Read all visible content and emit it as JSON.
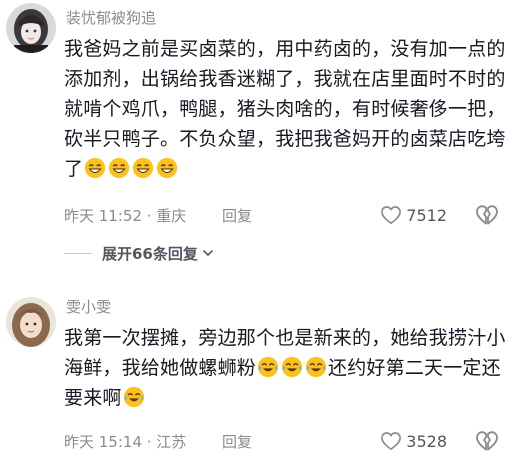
{
  "colors": {
    "text_primary": "#161823",
    "text_secondary": "#8a8b91",
    "emoji_face": "#fcc21b"
  },
  "comments": [
    {
      "username": "装忧郁被狗追",
      "text": "我爸妈之前是买卤菜的，用中药卤的，没有加一点的添加剂，出锅给我香迷糊了，我就在店里面时不时的就啃个鸡爪，鸭腿，猪头肉啥的，有时候奢侈一把，砍半只鸭子。不负众望，我把我爸妈开的卤菜店吃垮了",
      "emojis": [
        "grin-emoji",
        "grin-emoji",
        "grin-emoji",
        "grin-emoji"
      ],
      "meta": "昨天 11:52 · 重庆",
      "reply_label": "回复",
      "like_count": "7512",
      "expand_label": "展开66条回复"
    },
    {
      "username": "雯小雯",
      "text_before": "我第一次摆摊，旁边那个也是新来的，她给我捞汁小海鲜，我给她做螺蛳粉",
      "emojis_mid": [
        "laugh-cry-emoji",
        "laugh-cry-emoji",
        "laugh-cry-emoji"
      ],
      "text_after": "还约好第二天一定还要来啊",
      "emojis_end": [
        "laugh-cry-emoji"
      ],
      "meta": "昨天 15:14 · 江苏",
      "reply_label": "回复",
      "like_count": "3528"
    }
  ]
}
